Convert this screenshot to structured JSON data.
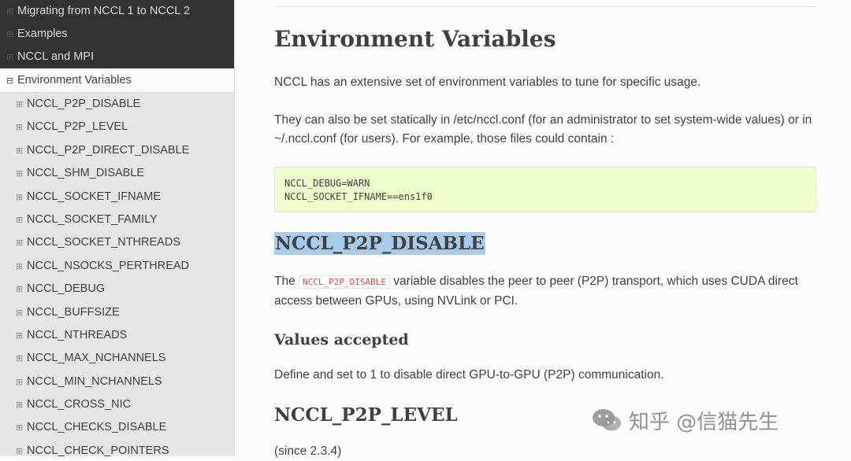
{
  "sidebar": {
    "toggle_collapsed": "⊞",
    "toggle_expanded": "⊟",
    "top_items": [
      {
        "label": "Migrating from NCCL 1 to NCCL 2"
      },
      {
        "label": "Examples"
      },
      {
        "label": "NCCL and MPI"
      }
    ],
    "active_item": {
      "label": "Environment Variables"
    },
    "sub_items": [
      {
        "label": "NCCL_P2P_DISABLE"
      },
      {
        "label": "NCCL_P2P_LEVEL"
      },
      {
        "label": "NCCL_P2P_DIRECT_DISABLE"
      },
      {
        "label": "NCCL_SHM_DISABLE"
      },
      {
        "label": "NCCL_SOCKET_IFNAME"
      },
      {
        "label": "NCCL_SOCKET_FAMILY"
      },
      {
        "label": "NCCL_SOCKET_NTHREADS"
      },
      {
        "label": "NCCL_NSOCKS_PERTHREAD"
      },
      {
        "label": "NCCL_DEBUG"
      },
      {
        "label": "NCCL_BUFFSIZE"
      },
      {
        "label": "NCCL_NTHREADS"
      },
      {
        "label": "NCCL_MAX_NCHANNELS"
      },
      {
        "label": "NCCL_MIN_NCHANNELS"
      },
      {
        "label": "NCCL_CROSS_NIC"
      },
      {
        "label": "NCCL_CHECKS_DISABLE"
      },
      {
        "label": "NCCL_CHECK_POINTERS"
      }
    ]
  },
  "main": {
    "title": "Environment Variables",
    "intro": "NCCL has an extensive set of environment variables to tune for specific usage.",
    "config_para_line1": "They can also be set statically in /etc/nccl.conf (for an administrator to set system-wide values) or in",
    "config_para_line2": "~/.nccl.conf (for users). For example, those files could contain :",
    "code_lines": [
      "NCCL_DEBUG=WARN",
      "NCCL_SOCKET_IFNAME==ens1f0"
    ],
    "section1": {
      "heading": "NCCL_P2P_DISABLE",
      "desc_prefix": "The ",
      "desc_code": "NCCL_P2P_DISABLE",
      "desc_suffix": " variable disables the peer to peer (P2P) transport, which uses CUDA direct",
      "desc_line2": "access between GPUs, using NVLink or PCI.",
      "values_heading": "Values accepted",
      "values_text": "Define and set to 1 to disable direct GPU-to-GPU (P2P) communication."
    },
    "section2": {
      "heading": "NCCL_P2P_LEVEL",
      "since": "(since 2.3.4)"
    }
  },
  "watermark": {
    "text": "知乎 @信猫先生",
    "icon": "wechat-chat-bubble-icon"
  },
  "colors": {
    "sidebar_dark": "#343131",
    "sidebar_light": "#e6e6e6",
    "code_bg": "#eeffcc",
    "highlight": "#a7cbec",
    "inline_code": "#e74c3c"
  }
}
